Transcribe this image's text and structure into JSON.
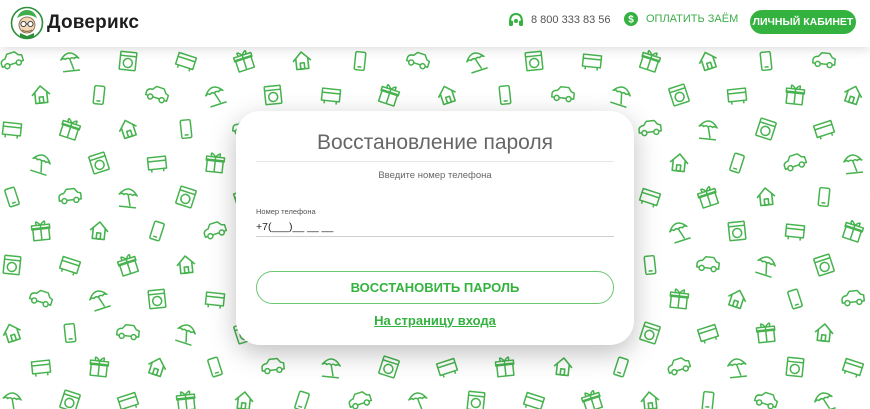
{
  "header": {
    "logo_text": "Доверикс",
    "phone": "8 800 333 83 56",
    "pay_label": "ОПЛАТИТЬ ЗАЁМ",
    "cabinet_label": "ЛИЧНЫЙ КАБИНЕТ"
  },
  "card": {
    "title": "Восстановление пароля",
    "hint": "Введите номер телефона",
    "phone_label": "Номер телефона",
    "phone_value": "+7(___)__ __ __",
    "restore_button": "ВОССТАНОВИТЬ ПАРОЛЬ",
    "login_link": "На страницу входа"
  },
  "colors": {
    "brand_green": "#34b23f",
    "pattern_green": "#46b34e"
  },
  "background": {
    "pattern_icons": [
      "car-icon",
      "gift-icon",
      "umbrella-icon",
      "house-icon",
      "washing-machine-icon",
      "phone-icon",
      "sofa-icon"
    ]
  }
}
